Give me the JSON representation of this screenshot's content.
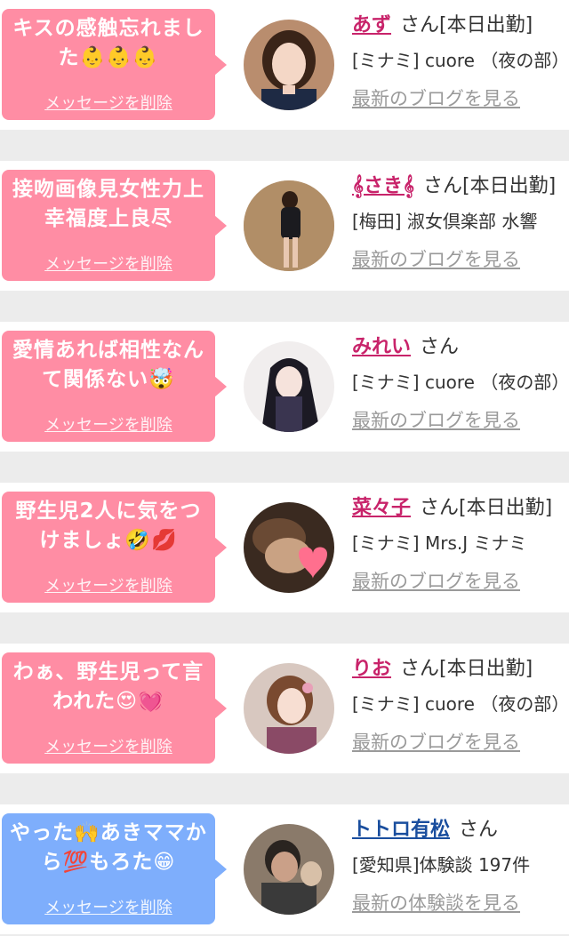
{
  "cards": [
    {
      "message": "キスの感触忘れました👶👶👶",
      "delete_label": "メッセージを削除",
      "name": "あず",
      "suffix": "さん[本日出勤]",
      "shop": "[ミナミ] cuore （夜の部）",
      "link": "最新のブログを見る"
    },
    {
      "message": "接吻画像見女性力上幸福度上良尽",
      "delete_label": "メッセージを削除",
      "name": "𝄞さき𝄞",
      "suffix": "さん[本日出勤]",
      "shop": "[梅田] 淑女倶楽部 水響",
      "link": "最新のブログを見る"
    },
    {
      "message": "愛情あれば相性なんて関係ない🤯",
      "delete_label": "メッセージを削除",
      "name": "みれい",
      "suffix": "さん",
      "shop": "[ミナミ] cuore （夜の部）",
      "link": "最新のブログを見る"
    },
    {
      "message": "野生児2人に気をつけましょ🤣💋",
      "delete_label": "メッセージを削除",
      "name": "菜々子",
      "suffix": "さん[本日出勤]",
      "shop": "[ミナミ] Mrs.J ミナミ",
      "link": "最新のブログを見る"
    },
    {
      "message": "わぁ、野生児って言われた😍💓",
      "delete_label": "メッセージを削除",
      "name": "りお",
      "suffix": "さん[本日出勤]",
      "shop": "[ミナミ] cuore （夜の部）",
      "link": "最新のブログを見る"
    },
    {
      "message": "やった🙌あきママから💯もろた😁",
      "delete_label": "メッセージを削除",
      "name": "トトロ有松",
      "suffix": "さん",
      "shop": "[愛知県]体験談 197件",
      "link": "最新の体験談を見る"
    }
  ],
  "colors": {
    "bubble_pink": "#ff8da4",
    "bubble_blue": "#7eaefc",
    "name_pink": "#c8236a",
    "name_blue": "#1a4e9e",
    "link_gray": "#9a9a9a"
  }
}
